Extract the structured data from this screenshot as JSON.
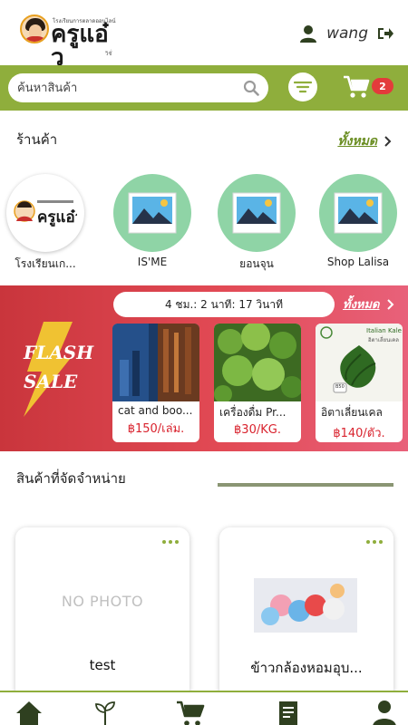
{
  "header": {
    "logo_small_text": "โรงเรียนการตลาดออนไลน์",
    "logo_main_text": "ครูแอ๋ว",
    "logo_tag_text": "วิชั่",
    "username": "wang"
  },
  "search": {
    "placeholder": "ค้นหาสินค้า",
    "cart_count": "2"
  },
  "shops_section": {
    "title": "ร้านค้า",
    "see_all": "ทั้งหมด",
    "shops": [
      {
        "name": "โรงเรียนเก..."
      },
      {
        "name": "IS'ME"
      },
      {
        "name": "ยอนจุน"
      },
      {
        "name": "Shop Lalisa"
      }
    ]
  },
  "flash_sale": {
    "label_line1": "FLASH",
    "label_line2": "SALE",
    "timer": "4 ชม.: 2 นาที: 17 วินาที",
    "see_all": "ทั้งหมด",
    "items": [
      {
        "name": "cat and boo...",
        "price": "฿150/เล่ม."
      },
      {
        "name": "เครื่องดื่ม Pr...",
        "price": "฿30/KG."
      },
      {
        "name": "อิตาเลี่ยนเคล",
        "price": "฿140/ตัว."
      }
    ],
    "kale_label": "Italian Kale",
    "kale_sub": "อิตาเลี่ยนเคล",
    "kale_weight": "B50"
  },
  "products_section": {
    "title": "สินค้าที่จัดจำหน่าย",
    "no_photo": "NO PHOTO",
    "products": [
      {
        "name": "test"
      },
      {
        "name": "ข้าวกล้องหอมอุบ..."
      }
    ]
  },
  "colors": {
    "brand_green": "#8fae3c",
    "flash_red": "#d63c47",
    "price_red": "#d9232e",
    "badge_red": "#e33b3b"
  }
}
